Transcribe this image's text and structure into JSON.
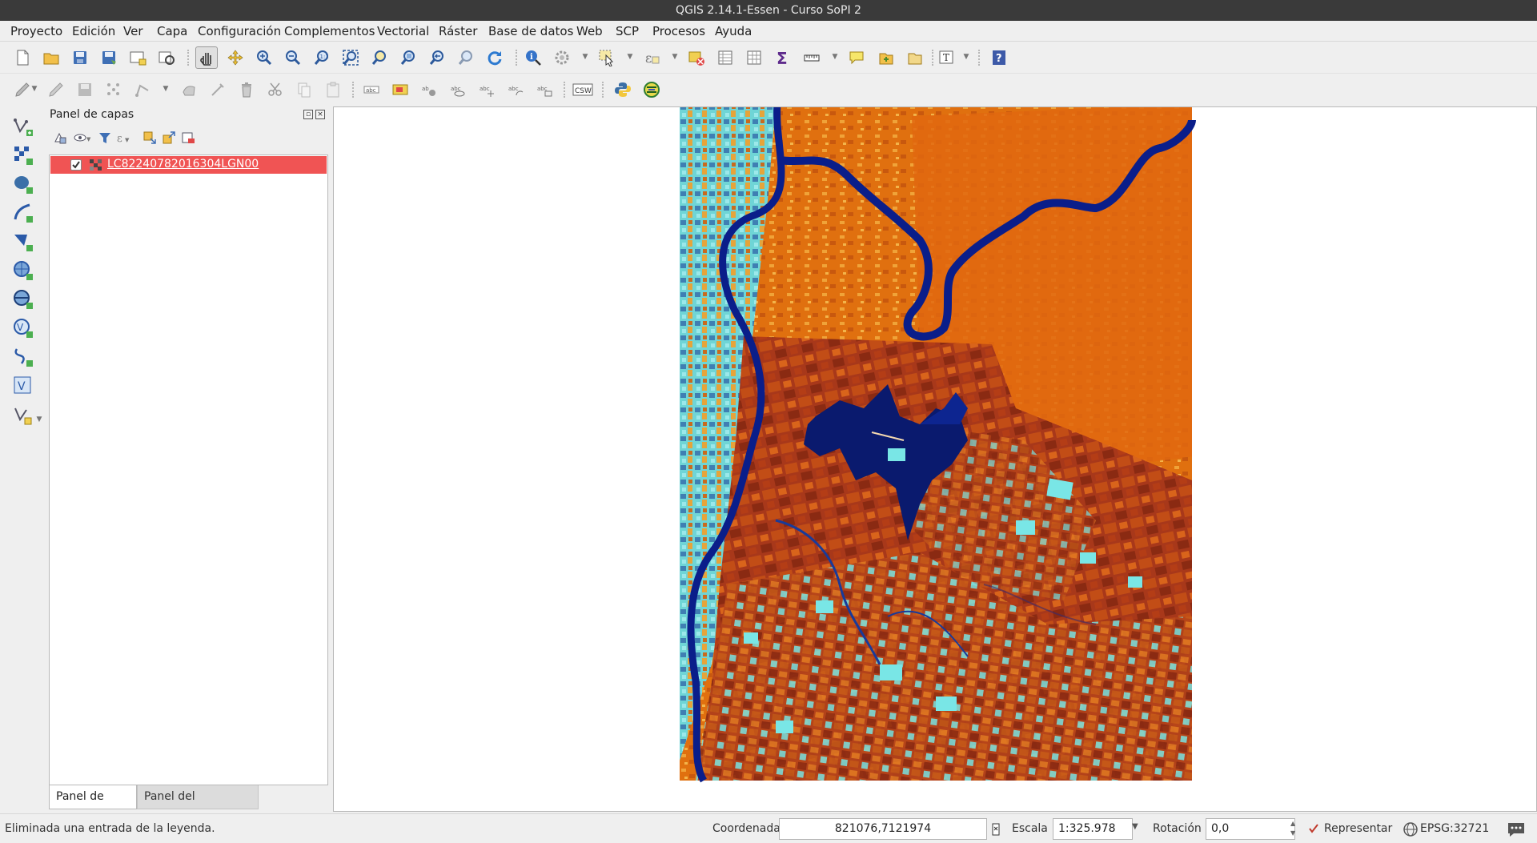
{
  "window": {
    "title": "QGIS 2.14.1-Essen - Curso SoPI 2"
  },
  "menu": [
    "Proyecto",
    "Edición",
    "Ver",
    "Capa",
    "Configuración",
    "Complementos",
    "Vectorial",
    "Ráster",
    "Base de datos",
    "Web",
    "SCP",
    "Procesos",
    "Ayuda"
  ],
  "toolbar1": {
    "icons": [
      "new-project-icon",
      "open-project-icon",
      "save-project-icon",
      "save-as-icon",
      "new-print-composer-icon",
      "composer-manager-icon",
      "pan-icon",
      "pan-to-selection-icon",
      "zoom-in-icon",
      "zoom-out-icon",
      "zoom-native-icon",
      "zoom-full-icon",
      "zoom-to-selection-icon",
      "zoom-to-layer-icon",
      "zoom-last-icon",
      "zoom-next-icon",
      "refresh-icon",
      "identify-icon",
      "action-icon",
      "select-icon",
      "select-expression-icon",
      "deselect-icon",
      "attribute-table-icon",
      "field-calculator-icon",
      "statistics-icon",
      "measure-icon",
      "map-tips-icon",
      "new-bookmark-icon",
      "show-bookmarks-icon",
      "text-annotation-icon",
      "help-icon"
    ]
  },
  "toolbar2": {
    "icons": [
      "current-edits-icon",
      "toggle-editing-icon",
      "save-edits-icon",
      "digitize-node-icon",
      "add-feature-icon",
      "node-tool-icon",
      "move-feature-icon",
      "delete-selected-icon",
      "cut-features-icon",
      "copy-features-icon",
      "paste-features-icon",
      "label-icon",
      "label-highlight-icon",
      "pin-label-icon",
      "show-hide-label-icon",
      "move-label-icon",
      "rotate-label-icon",
      "change-label-icon",
      "csw-icon",
      "python-console-icon",
      "scp-plugin-icon"
    ],
    "csw_text": "CSW"
  },
  "left_toolbar": {
    "icons": [
      "add-vector-layer-icon",
      "add-raster-layer-icon",
      "add-postgis-layer-icon",
      "add-spatialite-layer-icon",
      "add-mssql-layer-icon",
      "add-wms-layer-icon",
      "add-wcs-layer-icon",
      "add-wfs-layer-icon",
      "add-delimited-text-icon",
      "add-virtual-layer-icon",
      "new-vector-layer-icon"
    ]
  },
  "layers_panel": {
    "title": "Panel de capas",
    "toolbar_icons": [
      "open-styling-icon",
      "manage-visibility-icon",
      "filter-legend-icon",
      "filter-expression-icon",
      "expand-all-icon",
      "collapse-all-icon",
      "remove-layer-icon"
    ],
    "layers": [
      {
        "name": "LC82240782016304LGN00",
        "checked": true,
        "selected": true
      }
    ],
    "tabs": [
      "Panel de capas",
      "Panel del explorador"
    ],
    "active_tab": "Panel de capas"
  },
  "map": {
    "description_colors": {
      "land": "#e0670f",
      "water": "#0a1a7a",
      "crop": "#9a2b12",
      "bare": "#7ae7e8"
    }
  },
  "status": {
    "message": "Eliminada una entrada de la leyenda.",
    "coord_label": "Coordenada",
    "coord_value": "821076,7121974",
    "scale_label": "Escala",
    "scale_value": "1:325.978",
    "rotation_label": "Rotación",
    "rotation_value": "0,0",
    "render_label": "Representar",
    "render_checked": true,
    "crs": "EPSG:32721"
  }
}
